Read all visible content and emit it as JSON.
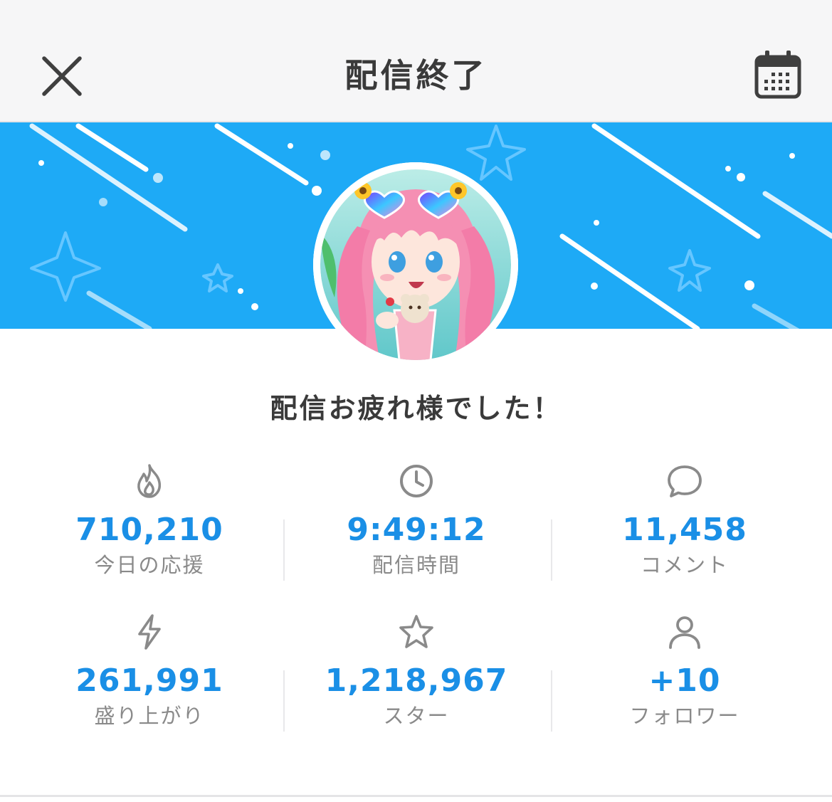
{
  "header": {
    "title": "配信終了",
    "close_icon": "close-icon",
    "calendar_icon": "calendar-icon"
  },
  "banner": {
    "background_color": "#1eaaf6"
  },
  "message": "配信お疲れ様でした！",
  "stats": [
    {
      "icon": "flame-icon",
      "value": "710,210",
      "label": "今日の応援"
    },
    {
      "icon": "clock-icon",
      "value": "9:49:12",
      "label": "配信時間"
    },
    {
      "icon": "comment-icon",
      "value": "11,458",
      "label": "コメント"
    },
    {
      "icon": "lightning-icon",
      "value": "261,991",
      "label": "盛り上がり"
    },
    {
      "icon": "star-icon",
      "value": "1,218,967",
      "label": "スター"
    },
    {
      "icon": "person-icon",
      "value": "+10",
      "label": "フォロワー"
    }
  ],
  "colors": {
    "accent": "#1a8fe6",
    "label": "#8a8a8a",
    "title": "#3a3a3a"
  }
}
